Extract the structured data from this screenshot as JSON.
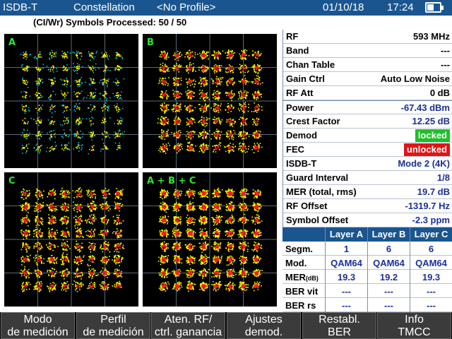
{
  "header": {
    "standard": "ISDB-T",
    "mode": "Constellation",
    "profile": "<No Profile>",
    "date": "01/10/18",
    "time": "17:24",
    "battery_level": 0.55
  },
  "status_line": "(CI/Wr) Symbols Processed:  50 / 50",
  "constellation": {
    "grid_size": 8,
    "panels": [
      {
        "label": "A"
      },
      {
        "label": "B"
      },
      {
        "label": "C"
      },
      {
        "label": "A + B + C"
      }
    ],
    "colors": {
      "background": "#000000",
      "low": "#00c8d8",
      "mid": "#ffff00",
      "high": "#ff2020",
      "grid": "#5a6a7a"
    }
  },
  "measurements": [
    {
      "key": "RF",
      "value": "593 MHz"
    },
    {
      "key": "Band",
      "value": "---"
    },
    {
      "key": "Chan Table",
      "value": "---"
    },
    {
      "key": "Gain Ctrl",
      "value": "Auto Low Noise"
    },
    {
      "key": "RF Att",
      "value": "0 dB"
    },
    {
      "key": "Power",
      "value": "-67.43 dBm"
    },
    {
      "key": "Crest Factor",
      "value": "12.25 dB"
    },
    {
      "key": "Demod",
      "value": "locked"
    },
    {
      "key": "FEC",
      "value": "unlocked"
    },
    {
      "key": "ISDB-T",
      "value": "Mode 2 (4K)"
    },
    {
      "key": "Guard Interval",
      "value": "1/8"
    },
    {
      "key": "MER (total, rms)",
      "value": "19.7 dB"
    },
    {
      "key": "RF Offset",
      "value": "-1319.7 Hz"
    },
    {
      "key": "Symbol Offset",
      "value": "-2.3 ppm"
    }
  ],
  "status_colors": {
    "locked": "#1fbf2a",
    "unlocked": "#e01515"
  },
  "layers": {
    "headers": [
      "Layer A",
      "Layer B",
      "Layer C"
    ],
    "rows": [
      {
        "key": "Segm.",
        "values": [
          "1",
          "6",
          "6"
        ]
      },
      {
        "key": "Mod.",
        "values": [
          "QAM64",
          "QAM64",
          "QAM64"
        ]
      },
      {
        "key": "MER",
        "unit": "(dB)",
        "values": [
          "19.3",
          "19.2",
          "19.3"
        ]
      },
      {
        "key": "BER vit",
        "values": [
          "---",
          "---",
          "---"
        ]
      },
      {
        "key": "BER rs",
        "values": [
          "---",
          "---",
          "---"
        ]
      }
    ]
  },
  "softkeys": [
    {
      "line1": "Modo",
      "line2": "de medición"
    },
    {
      "line1": "Perfil",
      "line2": "de medición"
    },
    {
      "line1": "Aten. RF/",
      "line2": "ctrl. ganancia"
    },
    {
      "line1": "Ajustes",
      "line2": "demod."
    },
    {
      "line1": "Restabl.",
      "line2": "BER"
    },
    {
      "line1": "Info",
      "line2": "TMCC"
    }
  ]
}
